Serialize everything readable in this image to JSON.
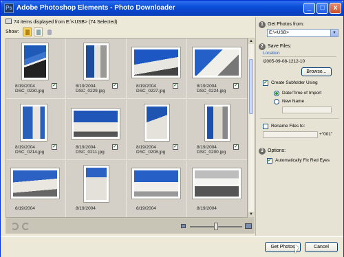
{
  "window": {
    "title": "Adobe Photoshop Elements - Photo Downloader",
    "buttons": {
      "minimize": "_",
      "maximize": "□",
      "close": "x"
    }
  },
  "status": {
    "text": "74 items displayed from E:\\<USB> (74 Selected)"
  },
  "show": {
    "label": "Show:"
  },
  "photos": [
    {
      "date": "8/19/2004",
      "name": "DSC_0230.jpg",
      "checked": true
    },
    {
      "date": "8/19/2004",
      "name": "DSC_0229.jpg",
      "checked": true
    },
    {
      "date": "8/19/2004",
      "name": "DSC_0227.jpg",
      "checked": true
    },
    {
      "date": "8/19/2004",
      "name": "DSC_0224.jpg",
      "checked": true
    },
    {
      "date": "8/19/2004",
      "name": "DSC_0214.jpg",
      "checked": true
    },
    {
      "date": "8/19/2004",
      "name": "DSC_0211.jpg",
      "checked": true
    },
    {
      "date": "8/19/2004",
      "name": "DSC_0208.jpg",
      "checked": true
    },
    {
      "date": "8/19/2004",
      "name": "DSC_0200.jpg",
      "checked": true
    },
    {
      "date": "8/19/2004",
      "name": "",
      "checked": false
    },
    {
      "date": "8/19/2004",
      "name": "",
      "checked": false
    },
    {
      "date": "8/19/2004",
      "name": "",
      "checked": false
    },
    {
      "date": "8/19/2004",
      "name": "",
      "checked": false
    }
  ],
  "panel": {
    "step1": {
      "num": "1",
      "label": "Get Photos from:",
      "source": "E:\\<USB>"
    },
    "step2": {
      "num": "2",
      "label": "Save Files:",
      "location_label": "Location",
      "location_path": "\\2005-09-08-1212-10",
      "browse_label": "Browse...",
      "create_subfolder_label": "Create Subfolder Using",
      "create_subfolder_checked": true,
      "option_datetime": "Date/Time of Import",
      "option_newname": "New Name",
      "rename_label": "Rename Files to:",
      "rename_checked": false,
      "rename_suffix": "+\"001\""
    },
    "step3": {
      "num": "3",
      "label": "Options:",
      "fix_red_eyes_label": "Automatically Fix Red Eyes",
      "fix_red_eyes_checked": true
    }
  },
  "footer": {
    "get_photos": "Get Photos",
    "cancel": "Cancel"
  },
  "colors": {
    "titlebar": "#0a4fd8",
    "accent_link": "#2b5dbd",
    "check_green": "#1a7b1a"
  }
}
